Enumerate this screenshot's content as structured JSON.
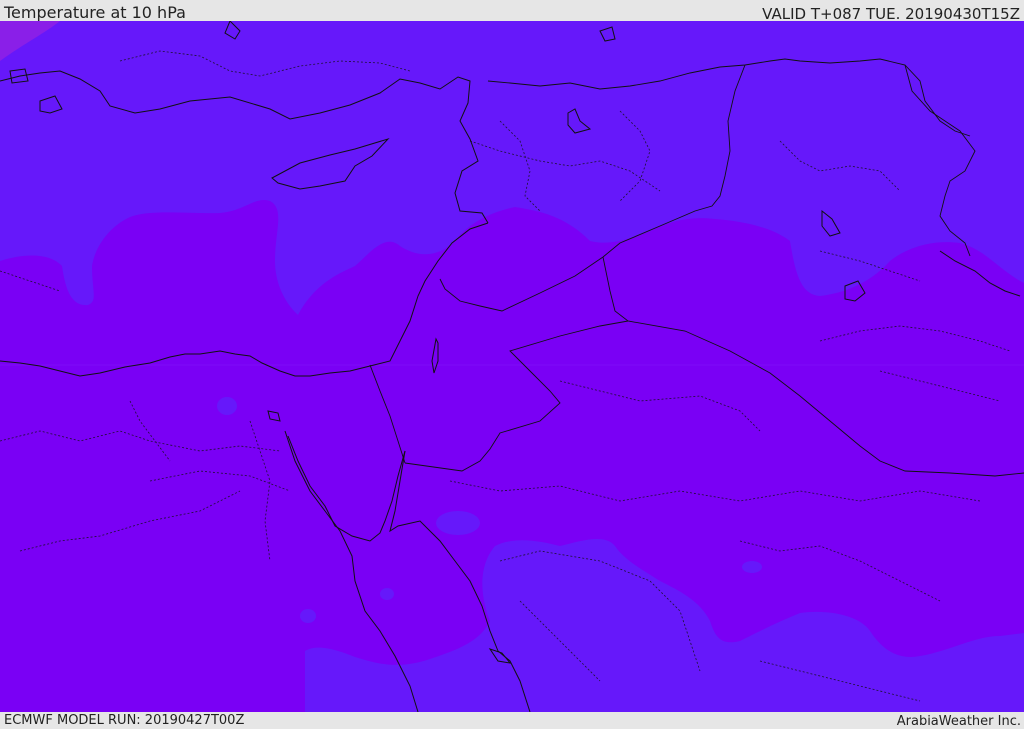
{
  "header": {
    "title": "Temperature at 10 hPa",
    "valid": "VALID T+087 TUE. 20190430T15Z"
  },
  "footer": {
    "model_run": "ECMWF MODEL RUN: 20190427T00Z",
    "credit": "ArabiaWeather Inc."
  },
  "map": {
    "field": "temperature",
    "level": "10 hPa",
    "colors": {
      "warm": "#7a00f5",
      "cool": "#6618fa",
      "coolest": "#8a1fe8",
      "border": "#111111"
    }
  }
}
